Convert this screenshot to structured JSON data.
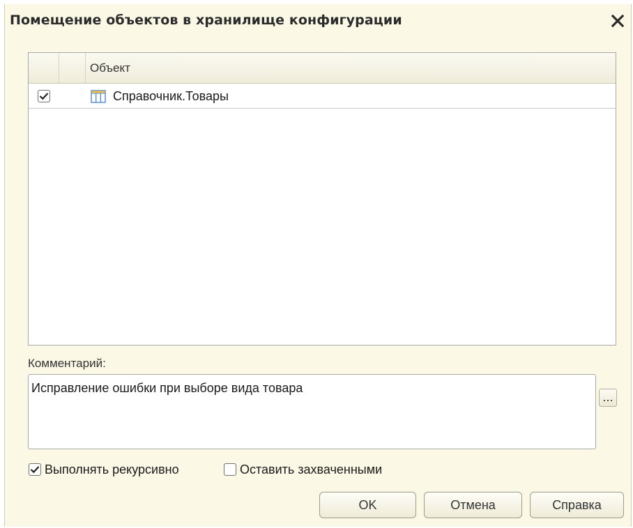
{
  "window": {
    "title": "Помещение объектов в хранилище конфигурации"
  },
  "table": {
    "column_object": "Объект",
    "rows": [
      {
        "checked": true,
        "icon": "catalog-table-icon",
        "name": "Справочник.Товары"
      }
    ]
  },
  "comment": {
    "label": "Комментарий:",
    "value": "Исправление ошибки при выборе вида товара",
    "select_button": "..."
  },
  "options": {
    "recursive": {
      "label": "Выполнять рекурсивно",
      "checked": true
    },
    "keep_locked": {
      "label": "Оставить захваченными",
      "checked": false
    }
  },
  "buttons": {
    "ok": "OK",
    "cancel": "Отмена",
    "help": "Справка"
  },
  "colors": {
    "background": "#fbf9e6",
    "border": "#a8a8a8",
    "icon_blue": "#5a8fd0"
  }
}
